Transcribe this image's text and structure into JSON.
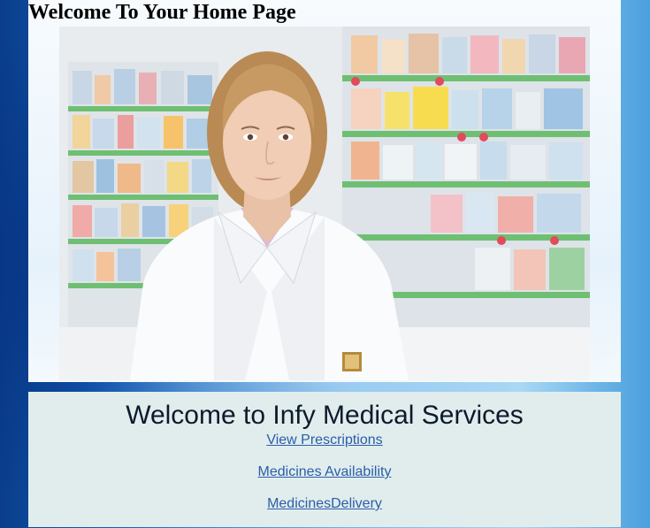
{
  "header": {
    "title": "Welcome To Your Home Page"
  },
  "hero": {
    "alt": "pharmacist-photo"
  },
  "services": {
    "title": "Welcome to Infy Medical Services",
    "links": [
      {
        "label": "View Prescriptions"
      },
      {
        "label": "Medicines Availability"
      },
      {
        "label": "MedicinesDelivery"
      }
    ]
  },
  "colors": {
    "link": "#2a5ea8",
    "panel": "#e1eded",
    "background_dark": "#0a3e8c",
    "background_light": "#9fd4f4"
  }
}
